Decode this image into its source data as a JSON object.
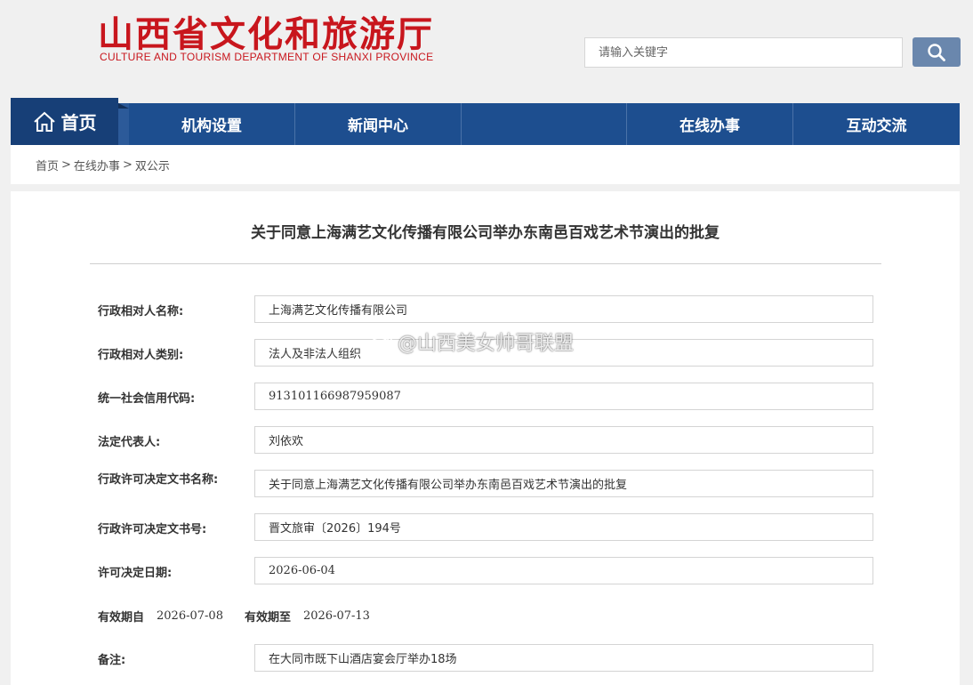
{
  "header": {
    "title_cn": "山西省文化和旅游厅",
    "title_en": "CULTURE AND TOURISM DEPARTMENT OF SHANXI PROVINCE",
    "search_placeholder": "请输入关键字",
    "brand_color": "#c8161d"
  },
  "nav": {
    "home": "首页",
    "items": [
      "机构设置",
      "新闻中心",
      "",
      "在线办事",
      "互动交流"
    ],
    "bg_color": "#1d4e8f"
  },
  "breadcrumb": {
    "items": [
      "首页",
      "在线办事",
      "双公示"
    ],
    "separator": ">"
  },
  "document": {
    "title": "关于同意上海满艺文化传播有限公司举办东南邑百戏艺术节演出的批复",
    "fields": [
      {
        "label": "行政相对人名称:",
        "value": "上海满艺文化传播有限公司"
      },
      {
        "label": "行政相对人类别:",
        "value": "法人及非法人组织"
      },
      {
        "label": "统一社会信用代码:",
        "value": "913101166987959087"
      },
      {
        "label": "法定代表人:",
        "value": "刘依欢"
      },
      {
        "label": "行政许可决定文书名称:",
        "value": "关于同意上海满艺文化传播有限公司举办东南邑百戏艺术节演出的批复"
      },
      {
        "label": "行政许可决定文书号:",
        "value": "晋文旅审〔2026〕194号"
      },
      {
        "label": "许可决定日期:",
        "value": "2026-06-04"
      }
    ],
    "valid_from_label": "有效期自",
    "valid_from": "2026-07-08",
    "valid_to_label": "有效期至",
    "valid_to": "2026-07-13",
    "remark_label": "备注:",
    "remark": "在大同市既下山酒店宴会厅举办18场"
  },
  "watermark": {
    "text": "@山西美女帅哥联盟"
  }
}
